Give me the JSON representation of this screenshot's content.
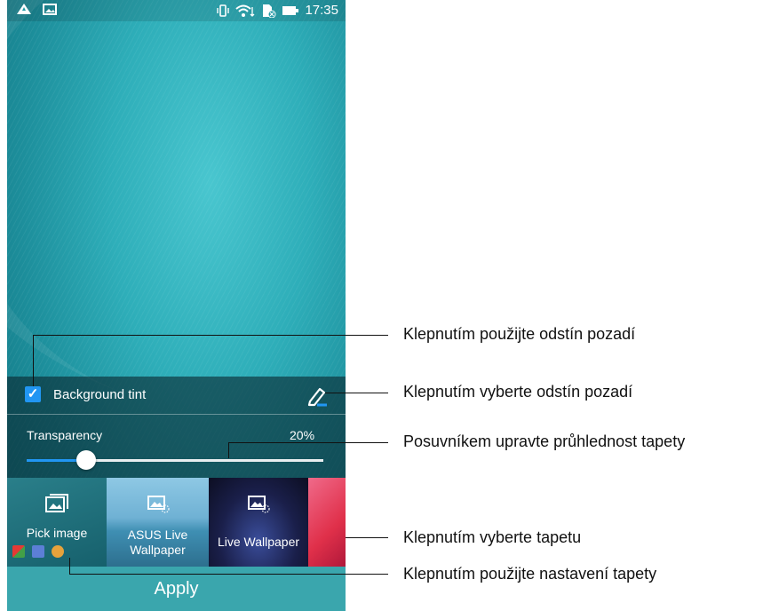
{
  "status_bar": {
    "left_icons": [
      "alert-icon",
      "image-icon"
    ],
    "right_icons": [
      "vibrate-icon",
      "wifi-icon",
      "sim-icon",
      "battery-icon"
    ],
    "time": "17:35"
  },
  "tint": {
    "checkbox_checked": true,
    "label": "Background tint"
  },
  "transparency": {
    "label": "Transparency",
    "value_text": "20%",
    "value": 0.2
  },
  "wallpapers": [
    {
      "label": "Pick image"
    },
    {
      "label": "ASUS Live Wallpaper"
    },
    {
      "label": "Live Wallpaper"
    }
  ],
  "apply_label": "Apply",
  "callouts": [
    "Klepnutím použijte odstín pozadí",
    "Klepnutím vyberte odstín pozadí",
    "Posuvníkem upravte průhlednost tapety",
    "Klepnutím vyberte tapetu",
    "Klepnutím použijte nastavení tapety"
  ],
  "colors": {
    "accent": "#2196f3",
    "apply_bar": "#3aa6ad"
  }
}
